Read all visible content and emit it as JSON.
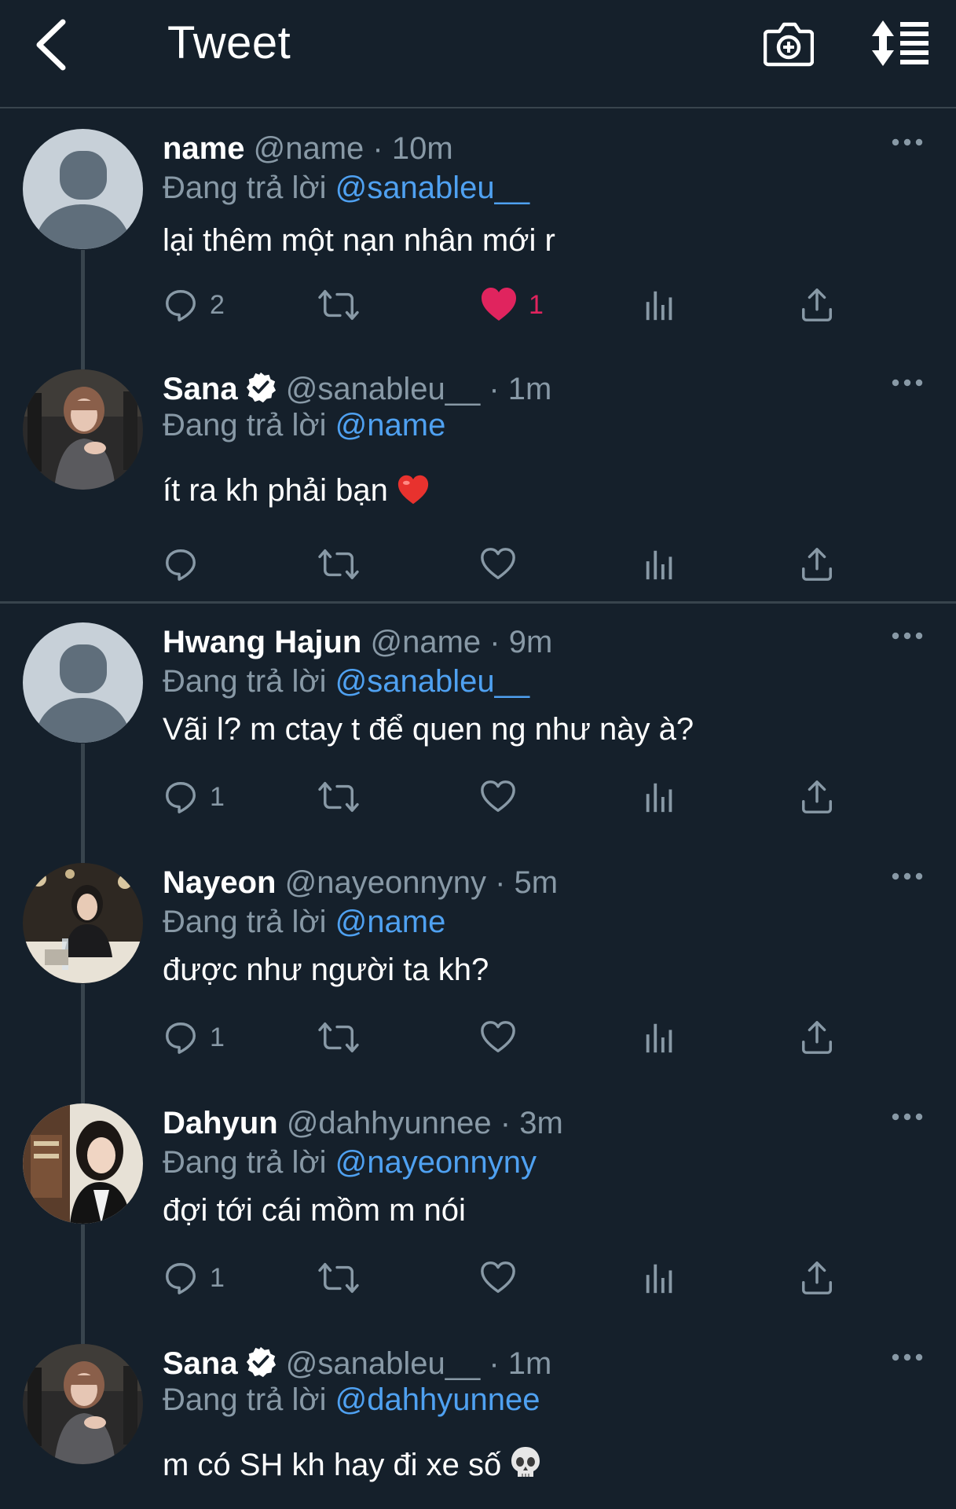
{
  "header": {
    "title": "Tweet"
  },
  "colors": {
    "background": "#15202b",
    "accent": "#4fa1f1",
    "muted": "#8899a6",
    "like": "#e0245e",
    "divider": "#38444d"
  },
  "icons": {
    "back": "chevron-left-icon",
    "camera": "camera-plus-icon",
    "sort": "sort-icon",
    "reply": "reply-icon",
    "retweet": "retweet-icon",
    "like": "heart-icon",
    "analytics": "analytics-icon",
    "share": "share-icon",
    "more": "more-icon",
    "verified": "verified-badge-icon"
  },
  "tweets": [
    {
      "name": "name",
      "handle": "@name",
      "dot": "·",
      "time": "10m",
      "reply_prefix": "Đang trả lời",
      "reply_to": "@sanableu__",
      "text": "lại thêm một nạn nhân mới r",
      "replies": "2",
      "likes": "1",
      "liked": true,
      "verified": false,
      "avatar": "default-avatar"
    },
    {
      "name": "Sana",
      "handle": "@sanableu__",
      "dot": "·",
      "time": "1m",
      "reply_prefix": "Đang trả lời",
      "reply_to": "@name",
      "text": "ít ra kh phải bạn",
      "emoji": "red-heart-emoji",
      "replies": "",
      "likes": "",
      "liked": false,
      "verified": true,
      "avatar": "photo-avatar-sana"
    },
    {
      "name": "Hwang Hajun",
      "handle": "@name",
      "dot": "·",
      "time": "9m",
      "reply_prefix": "Đang trả lời",
      "reply_to": "@sanableu__",
      "text": "Vãi l? m ctay t để quen ng như này à?",
      "replies": "1",
      "likes": "",
      "liked": false,
      "verified": false,
      "avatar": "default-avatar"
    },
    {
      "name": "Nayeon",
      "handle": "@nayeonnyny",
      "dot": "·",
      "time": "5m",
      "reply_prefix": "Đang trả lời",
      "reply_to": "@name",
      "text": "được như người ta kh?",
      "replies": "1",
      "likes": "",
      "liked": false,
      "verified": false,
      "avatar": "photo-avatar-nayeon"
    },
    {
      "name": "Dahyun",
      "handle": "@dahhyunnee",
      "dot": "·",
      "time": "3m",
      "reply_prefix": "Đang trả lời",
      "reply_to": "@nayeonnyny",
      "text": "đợi tới cái mồm m nói",
      "replies": "1",
      "likes": "",
      "liked": false,
      "verified": false,
      "avatar": "photo-avatar-dahyun"
    },
    {
      "name": "Sana",
      "handle": "@sanableu__",
      "dot": "·",
      "time": "1m",
      "reply_prefix": "Đang trả lời",
      "reply_to": "@dahhyunnee",
      "text": "m có SH kh hay đi xe số",
      "emoji": "skull-emoji",
      "replies": "",
      "likes": "",
      "liked": false,
      "verified": true,
      "avatar": "photo-avatar-sana"
    }
  ]
}
